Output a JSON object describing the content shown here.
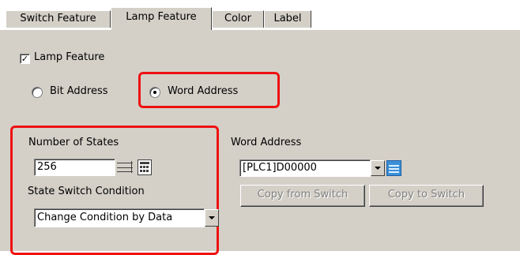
{
  "tabs": [
    {
      "label": "Switch Feature"
    },
    {
      "label": "Lamp Feature"
    },
    {
      "label": "Color"
    },
    {
      "label": "Label"
    }
  ],
  "lamp_feature": {
    "label": "Lamp Feature",
    "checked": true
  },
  "address_type": {
    "bit_label": "Bit Address",
    "word_label": "Word Address",
    "selected": "Word Address"
  },
  "states": {
    "label": "Number of States",
    "value": "256"
  },
  "condition": {
    "label": "State Switch Condition",
    "value": "Change Condition by Data"
  },
  "word_address": {
    "label": "Word Address",
    "value": "[PLC1]D00000"
  },
  "buttons": {
    "copy_from": "Copy from Switch",
    "copy_to": "Copy to Switch"
  },
  "colors": {
    "panel": "#d4d0c8",
    "highlight": "#ee1111"
  },
  "icons": {
    "calculator": "calculator-icon",
    "address_input": "keyboard-input-icon"
  }
}
